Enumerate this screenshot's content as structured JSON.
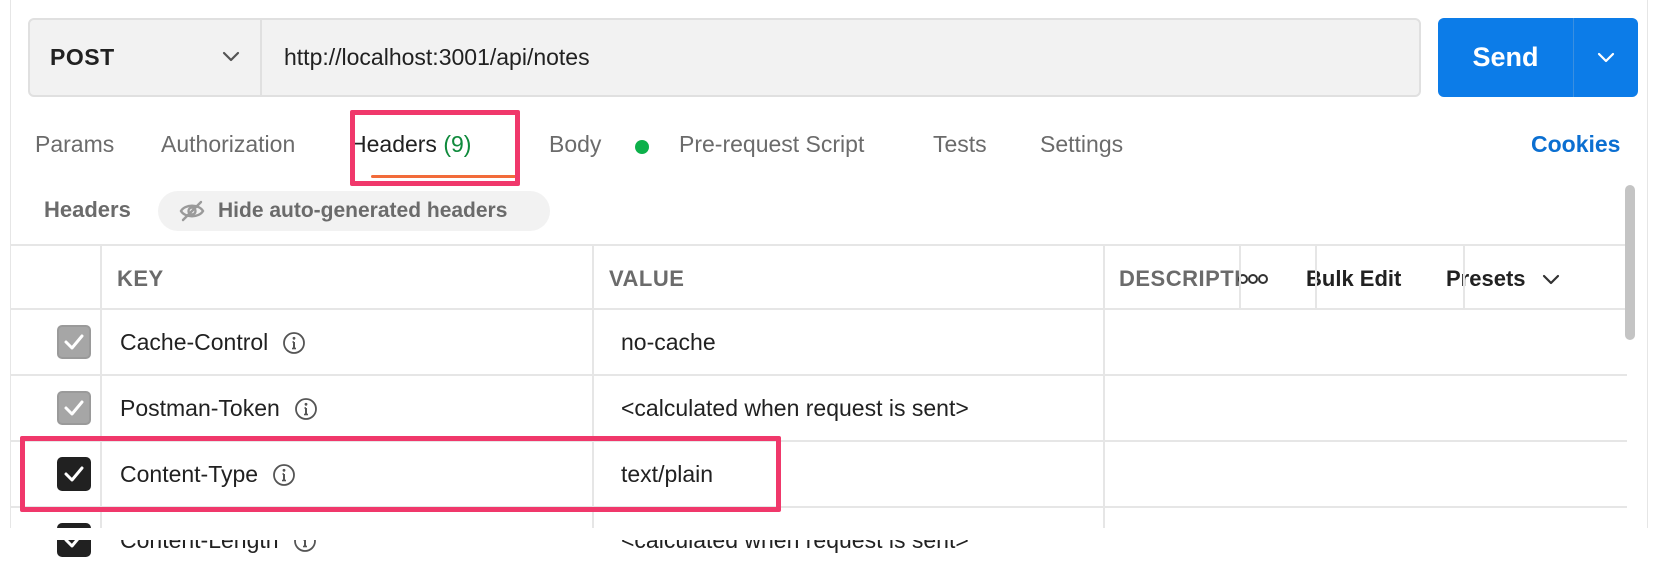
{
  "request": {
    "method": "POST",
    "url": "http://localhost:3001/api/notes",
    "send_label": "Send"
  },
  "tabs": [
    {
      "label": "Params"
    },
    {
      "label": "Authorization"
    },
    {
      "label": "Headers",
      "count": "(9)",
      "active": true
    },
    {
      "label": "Body",
      "indicator": "green-dot"
    },
    {
      "label": "Pre-request Script"
    },
    {
      "label": "Tests"
    },
    {
      "label": "Settings"
    }
  ],
  "cookies_label": "Cookies",
  "headers_section": {
    "title": "Headers",
    "hide_auto_label": "Hide auto-generated headers"
  },
  "table": {
    "columns": {
      "key": "KEY",
      "value": "VALUE",
      "description": "DESCRIPTION",
      "more": "ooo",
      "bulk_edit": "Bulk Edit",
      "presets": "Presets"
    },
    "rows": [
      {
        "checked": true,
        "auto": true,
        "key": "Cache-Control",
        "value": "no-cache"
      },
      {
        "checked": true,
        "auto": true,
        "key": "Postman-Token",
        "value": "<calculated when request is sent>"
      },
      {
        "checked": true,
        "auto": false,
        "key": "Content-Type",
        "value": "text/plain"
      },
      {
        "checked": true,
        "auto": false,
        "key": "Content-Length",
        "value": "<calculated when request is sent>"
      }
    ]
  },
  "colors": {
    "send_button": "#0c7ce8",
    "active_tab_underline": "#f26b3a",
    "header_count": "#0f8a3c",
    "body_indicator": "#0cb04a",
    "highlight_annotation": "#f0386b",
    "link": "#0b6fd1"
  }
}
